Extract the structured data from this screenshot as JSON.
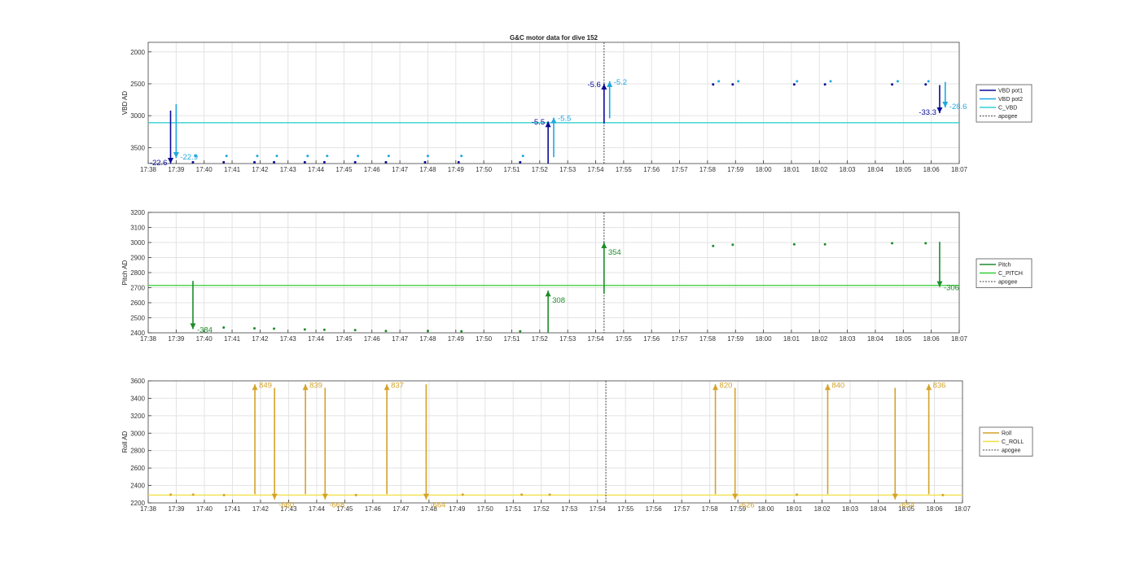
{
  "title": "G&C motor data for dive 152",
  "time_ticks": [
    "17:38",
    "17:39",
    "17:40",
    "17:41",
    "17:42",
    "17:43",
    "17:44",
    "17:45",
    "17:46",
    "17:47",
    "17:48",
    "17:49",
    "17:50",
    "17:51",
    "17:52",
    "17:53",
    "17:54",
    "17:55",
    "17:56",
    "17:57",
    "17:58",
    "17:59",
    "18:00",
    "18:01",
    "18:02",
    "18:03",
    "18:04",
    "18:05",
    "18:06",
    "18:07"
  ],
  "colors": {
    "vbd_pot1": "#0a0a96",
    "vbd_pot2": "#1fa8e0",
    "c_vbd": "#35d0d0",
    "pitch": "#1e8c2a",
    "c_pitch": "#33cc33",
    "roll": "#d4a32a",
    "c_roll": "#f0e040",
    "apogee": "#444444"
  },
  "chart_data": [
    {
      "type": "scatter",
      "title": "G&C motor data for dive 152",
      "xlabel": "",
      "ylabel": "VBD AD",
      "xlim": [
        "17:38",
        "18:07"
      ],
      "ylim": [
        3750,
        1850
      ],
      "y_reversed": true,
      "yticks": [
        2000,
        2500,
        3000,
        3500
      ],
      "grid": true,
      "legend_position": "right",
      "legend": [
        "VBD pot1",
        "VBD pot2",
        "C_VBD",
        "apogee"
      ],
      "hline": {
        "name": "C_VBD",
        "value": 3110
      },
      "apogee": "17:54.3",
      "series": [
        {
          "name": "VBD pot1",
          "x": [
            "17:39.6",
            "17:40.7",
            "17:41.8",
            "17:42.5",
            "17:43.6",
            "17:44.3",
            "17:45.4",
            "17:46.5",
            "17:47.9",
            "17:49.1",
            "17:51.3",
            "17:58.2",
            "17:58.9",
            "18:01.1",
            "18:02.2",
            "18:04.6",
            "18:05.8"
          ],
          "y": [
            3730,
            3730,
            3730,
            3730,
            3730,
            3730,
            3730,
            3730,
            3730,
            3730,
            3730,
            2510,
            2510,
            2510,
            2510,
            2510,
            2510
          ]
        },
        {
          "name": "VBD pot2",
          "x": [
            "17:39.7",
            "17:40.8",
            "17:41.9",
            "17:42.6",
            "17:43.7",
            "17:44.4",
            "17:45.5",
            "17:46.6",
            "17:48.0",
            "17:49.2",
            "17:51.4",
            "17:58.4",
            "17:59.1",
            "18:01.2",
            "18:02.4",
            "18:04.8",
            "18:05.9"
          ],
          "y": [
            3630,
            3630,
            3630,
            3630,
            3630,
            3630,
            3630,
            3630,
            3630,
            3630,
            3630,
            2460,
            2460,
            2460,
            2460,
            2460,
            2460
          ]
        }
      ],
      "moves": [
        {
          "series": "VBD pot1",
          "x": "17:38.8",
          "from": 2920,
          "to": 3750,
          "label": "-22.6",
          "label_side": "left"
        },
        {
          "series": "VBD pot2",
          "x": "17:39.0",
          "from": 2820,
          "to": 3660,
          "label": "-22.9",
          "label_side": "right"
        },
        {
          "series": "VBD pot1",
          "x": "17:52.3",
          "from": 3750,
          "to": 3090,
          "label": "-5.5",
          "label_side": "left"
        },
        {
          "series": "VBD pot2",
          "x": "17:52.5",
          "from": 3650,
          "to": 3030,
          "label": "-5.5",
          "label_side": "right"
        },
        {
          "series": "VBD pot1",
          "x": "17:54.3",
          "from": 3120,
          "to": 2500,
          "label": "-5.6",
          "label_side": "left"
        },
        {
          "series": "VBD pot2",
          "x": "17:54.5",
          "from": 3040,
          "to": 2460,
          "label": "-5.2",
          "label_side": "right"
        },
        {
          "series": "VBD pot1",
          "x": "18:06.3",
          "from": 2520,
          "to": 2960,
          "label": "-33.3",
          "label_side": "left"
        },
        {
          "series": "VBD pot2",
          "x": "18:06.5",
          "from": 2470,
          "to": 2870,
          "label": "-28.6",
          "label_side": "right"
        }
      ]
    },
    {
      "type": "scatter",
      "title": "",
      "xlabel": "",
      "ylabel": "Pitch AD",
      "xlim": [
        "17:38",
        "18:07"
      ],
      "ylim": [
        2400,
        3200
      ],
      "yticks": [
        2400,
        2500,
        2600,
        2700,
        2800,
        2900,
        3000,
        3100,
        3200
      ],
      "grid": true,
      "legend_position": "right",
      "legend": [
        "Pitch",
        "C_PITCH",
        "apogee"
      ],
      "hline": {
        "name": "C_PITCH",
        "value": 2715
      },
      "apogee": "17:54.3",
      "series": [
        {
          "name": "Pitch",
          "x": [
            "17:40.7",
            "17:41.8",
            "17:42.5",
            "17:43.6",
            "17:44.3",
            "17:45.4",
            "17:46.5",
            "17:48.0",
            "17:49.2",
            "17:51.3",
            "17:58.2",
            "17:58.9",
            "18:01.1",
            "18:02.2",
            "18:04.6",
            "18:05.8"
          ],
          "y": [
            2435,
            2430,
            2428,
            2422,
            2420,
            2418,
            2412,
            2412,
            2410,
            2410,
            2977,
            2985,
            2988,
            2988,
            2995,
            2995
          ]
        }
      ],
      "moves": [
        {
          "series": "Pitch",
          "x": "17:39.6",
          "from": 2745,
          "to": 2425,
          "label": "-384",
          "label_side": "right"
        },
        {
          "series": "Pitch",
          "x": "17:52.3",
          "from": 2400,
          "to": 2680,
          "label": "308",
          "label_side": "right"
        },
        {
          "series": "Pitch",
          "x": "17:54.3",
          "from": 2660,
          "to": 3000,
          "label": "354",
          "label_side": "right"
        },
        {
          "series": "Pitch",
          "x": "18:06.3",
          "from": 3005,
          "to": 2705,
          "label": "-306",
          "label_side": "right"
        }
      ]
    },
    {
      "type": "scatter",
      "title": "",
      "xlabel": "",
      "ylabel": "Roll AD",
      "xlim": [
        "17:38",
        "18:07"
      ],
      "ylim": [
        2200,
        3600
      ],
      "yticks": [
        2200,
        2400,
        2600,
        2800,
        3000,
        3200,
        3400,
        3600
      ],
      "grid": true,
      "legend_position": "right",
      "legend": [
        "Roll",
        "C_ROLL",
        "apogee"
      ],
      "hline": {
        "name": "C_ROLL",
        "value": 2290
      },
      "apogee": "17:54.3",
      "series": [
        {
          "name": "Roll",
          "x": [
            "17:38.8",
            "17:39.6",
            "17:40.7",
            "17:45.4",
            "17:49.2",
            "17:51.3",
            "17:52.3",
            "18:01.1",
            "18:06.3"
          ],
          "y": [
            2295,
            2295,
            2290,
            2290,
            2295,
            2295,
            2295,
            2295,
            2290
          ]
        }
      ],
      "moves": [
        {
          "series": "Roll",
          "x": "17:41.8",
          "from": 2300,
          "to": 3560,
          "label": "849",
          "label_side": "right"
        },
        {
          "series": "Roll",
          "x": "17:42.5",
          "from": 3520,
          "to": 2240,
          "label": "-660",
          "label_side": "right"
        },
        {
          "series": "Roll",
          "x": "17:43.6",
          "from": 2300,
          "to": 3560,
          "label": "839",
          "label_side": "right"
        },
        {
          "series": "Roll",
          "x": "17:44.3",
          "from": 3520,
          "to": 2240,
          "label": "-668",
          "label_side": "right"
        },
        {
          "series": "Roll",
          "x": "17:46.5",
          "from": 2300,
          "to": 3560,
          "label": "837",
          "label_side": "right"
        },
        {
          "series": "Roll",
          "x": "17:47.9",
          "from": 3560,
          "to": 2240,
          "label": "-664",
          "label_side": "right"
        },
        {
          "series": "Roll",
          "x": "17:58.2",
          "from": 2300,
          "to": 3560,
          "label": "820",
          "label_side": "right"
        },
        {
          "series": "Roll",
          "x": "17:58.9",
          "from": 3520,
          "to": 2240,
          "label": "-626",
          "label_side": "right"
        },
        {
          "series": "Roll",
          "x": "18:02.2",
          "from": 2300,
          "to": 3560,
          "label": "840",
          "label_side": "right"
        },
        {
          "series": "Roll",
          "x": "18:04.6",
          "from": 3520,
          "to": 2240,
          "label": "-654",
          "label_side": "right"
        },
        {
          "series": "Roll",
          "x": "18:05.8",
          "from": 2300,
          "to": 3560,
          "label": "836",
          "label_side": "right"
        }
      ]
    }
  ]
}
